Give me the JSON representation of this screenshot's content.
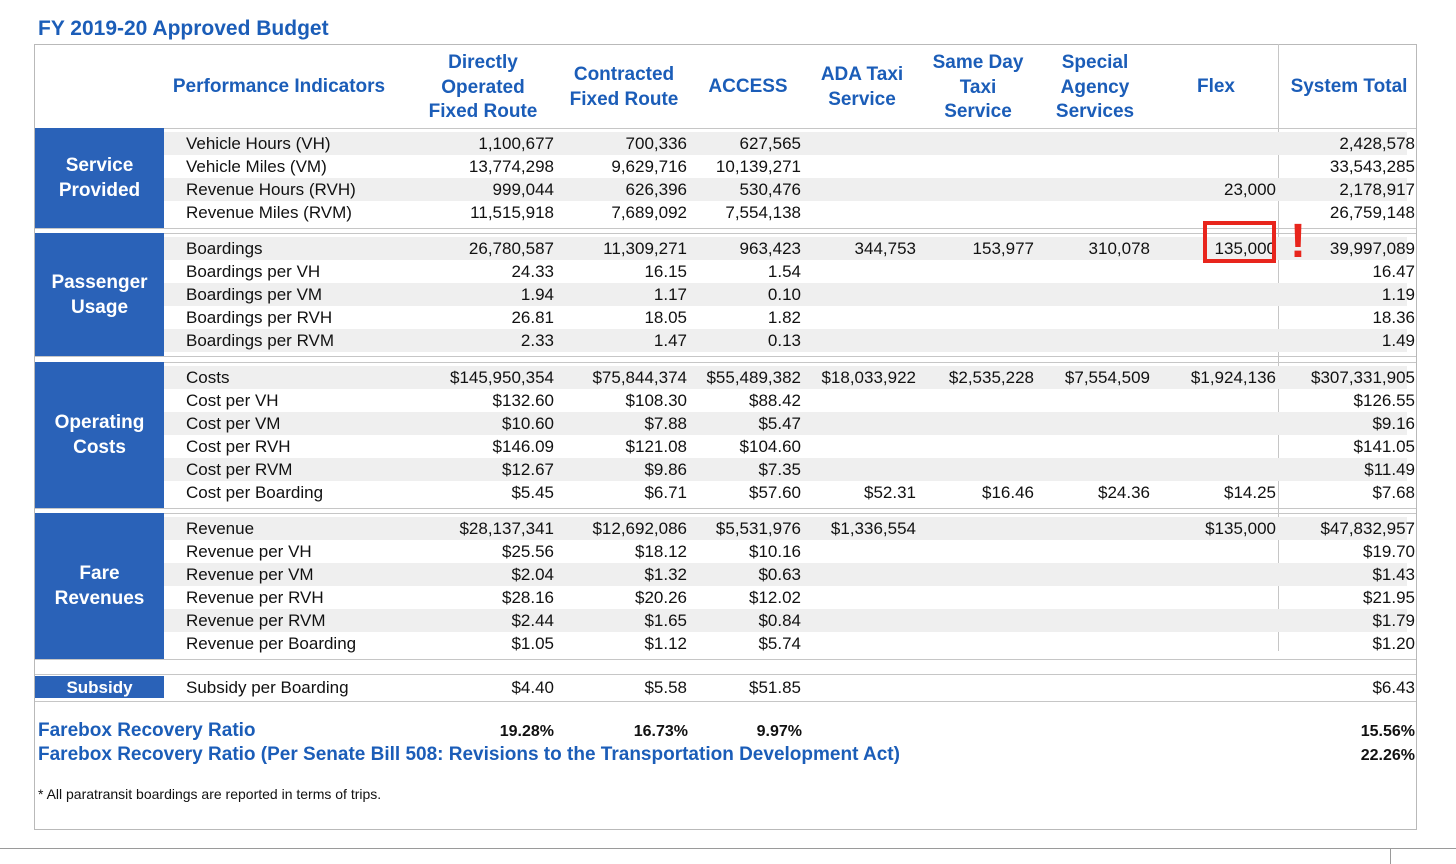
{
  "title": "FY 2019-20 Approved Budget",
  "headers": {
    "indicators": "Performance Indicators",
    "directly_operated": "Directly\nOperated\nFixed Route",
    "contracted": "Contracted\nFixed Route",
    "access": "ACCESS",
    "ada_taxi": "ADA Taxi\nService",
    "same_day": "Same Day\nTaxi\nService",
    "special_agency": "Special\nAgency\nServices",
    "flex": "Flex",
    "system_total": "System Total"
  },
  "sections": [
    {
      "label": "Service\nProvided",
      "rows": [
        {
          "label": "Vehicle Hours (VH)",
          "v": [
            "1,100,677",
            "700,336",
            "627,565",
            "",
            "",
            "",
            "",
            "2,428,578"
          ]
        },
        {
          "label": "Vehicle Miles (VM)",
          "v": [
            "13,774,298",
            "9,629,716",
            "10,139,271",
            "",
            "",
            "",
            "",
            "33,543,285"
          ]
        },
        {
          "label": "Revenue Hours (RVH)",
          "v": [
            "999,044",
            "626,396",
            "530,476",
            "",
            "",
            "",
            "23,000",
            "2,178,917"
          ]
        },
        {
          "label": "Revenue Miles (RVM)",
          "v": [
            "11,515,918",
            "7,689,092",
            "7,554,138",
            "",
            "",
            "",
            "",
            "26,759,148"
          ]
        }
      ]
    },
    {
      "label": "Passenger\nUsage",
      "rows": [
        {
          "label": "Boardings",
          "v": [
            "26,780,587",
            "11,309,271",
            "963,423",
            "344,753",
            "153,977",
            "310,078",
            "135,000",
            "39,997,089"
          ]
        },
        {
          "label": "Boardings per VH",
          "v": [
            "24.33",
            "16.15",
            "1.54",
            "",
            "",
            "",
            "",
            "16.47"
          ]
        },
        {
          "label": "Boardings per VM",
          "v": [
            "1.94",
            "1.17",
            "0.10",
            "",
            "",
            "",
            "",
            "1.19"
          ]
        },
        {
          "label": "Boardings per RVH",
          "v": [
            "26.81",
            "18.05",
            "1.82",
            "",
            "",
            "",
            "",
            "18.36"
          ]
        },
        {
          "label": "Boardings per RVM",
          "v": [
            "2.33",
            "1.47",
            "0.13",
            "",
            "",
            "",
            "",
            "1.49"
          ]
        }
      ]
    },
    {
      "label": "Operating\nCosts",
      "rows": [
        {
          "label": "Costs",
          "v": [
            "$145,950,354",
            "$75,844,374",
            "$55,489,382",
            "$18,033,922",
            "$2,535,228",
            "$7,554,509",
            "$1,924,136",
            "$307,331,905"
          ]
        },
        {
          "label": "Cost per VH",
          "v": [
            "$132.60",
            "$108.30",
            "$88.42",
            "",
            "",
            "",
            "",
            "$126.55"
          ]
        },
        {
          "label": "Cost per VM",
          "v": [
            "$10.60",
            "$7.88",
            "$5.47",
            "",
            "",
            "",
            "",
            "$9.16"
          ]
        },
        {
          "label": "Cost per RVH",
          "v": [
            "$146.09",
            "$121.08",
            "$104.60",
            "",
            "",
            "",
            "",
            "$141.05"
          ]
        },
        {
          "label": "Cost per RVM",
          "v": [
            "$12.67",
            "$9.86",
            "$7.35",
            "",
            "",
            "",
            "",
            "$11.49"
          ]
        },
        {
          "label": "Cost per Boarding",
          "v": [
            "$5.45",
            "$6.71",
            "$57.60",
            "$52.31",
            "$16.46",
            "$24.36",
            "$14.25",
            "$7.68"
          ]
        }
      ]
    },
    {
      "label": "Fare\nRevenues",
      "rows": [
        {
          "label": "Revenue",
          "v": [
            "$28,137,341",
            "$12,692,086",
            "$5,531,976",
            "$1,336,554",
            "",
            "",
            "$135,000",
            "$47,832,957"
          ]
        },
        {
          "label": "Revenue per VH",
          "v": [
            "$25.56",
            "$18.12",
            "$10.16",
            "",
            "",
            "",
            "",
            "$19.70"
          ]
        },
        {
          "label": "Revenue per VM",
          "v": [
            "$2.04",
            "$1.32",
            "$0.63",
            "",
            "",
            "",
            "",
            "$1.43"
          ]
        },
        {
          "label": "Revenue per RVH",
          "v": [
            "$28.16",
            "$20.26",
            "$12.02",
            "",
            "",
            "",
            "",
            "$21.95"
          ]
        },
        {
          "label": "Revenue per RVM",
          "v": [
            "$2.44",
            "$1.65",
            "$0.84",
            "",
            "",
            "",
            "",
            "$1.79"
          ]
        },
        {
          "label": "Revenue per Boarding",
          "v": [
            "$1.05",
            "$1.12",
            "$5.74",
            "",
            "",
            "",
            "",
            "$1.20"
          ]
        }
      ]
    },
    {
      "label": "Subsidy",
      "rows": [
        {
          "label": "Subsidy per Boarding",
          "v": [
            "$4.40",
            "$5.58",
            "$51.85",
            "",
            "",
            "",
            "",
            "$6.43"
          ]
        }
      ]
    }
  ],
  "farebox": {
    "label": "Farebox Recovery Ratio",
    "values": [
      "19.28%",
      "16.73%",
      "9.97%",
      "15.56%"
    ],
    "sb_label": "Farebox Recovery Ratio (Per Senate Bill 508: Revisions to the Transportation Development Act)",
    "sb_total": "22.26%"
  },
  "footnote": "* All paratransit boardings are reported in terms of trips.",
  "annotation": {
    "mark": "!",
    "color": "#e8251c"
  }
}
